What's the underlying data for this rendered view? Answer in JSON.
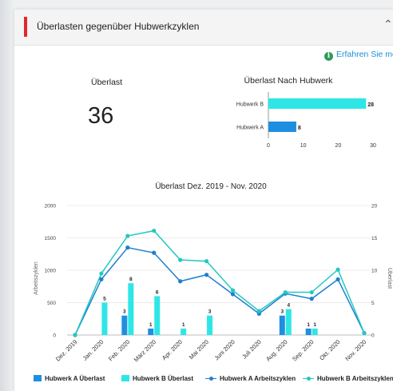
{
  "widget": {
    "title": "Überlasten gegenüber Hubwerkzyklen",
    "learn_more": "Erfahren Sie mehr",
    "collapse_icon": "chevron-up-icon",
    "info_icon": "info-icon"
  },
  "kpi": {
    "label": "Überlast",
    "value": "36"
  },
  "colors": {
    "accent": "#e3262d",
    "hubwerk_a": "#1e8fe0",
    "hubwerk_b": "#2ee6e6",
    "line_a": "#1f7fcf",
    "line_b": "#22c8c2"
  },
  "chart_data": [
    {
      "type": "bar",
      "orientation": "horizontal",
      "title": "Überlast Nach Hubwerk",
      "categories": [
        "Hubwerk B",
        "Hubwerk A"
      ],
      "values": [
        28,
        8
      ],
      "data_labels": [
        "28",
        "8"
      ],
      "xlim": [
        0,
        30
      ],
      "xticks": [
        "0",
        "10",
        "20",
        "30"
      ]
    },
    {
      "type": "bar",
      "title": "Überlast Dez. 2019 - Nov. 2020",
      "categories": [
        "Dez. 2019",
        "Jan. 2020",
        "Feb. 2020",
        "März 2020",
        "Apr. 2020",
        "Mai 2020",
        "Juni 2020",
        "Juli 2020",
        "Aug. 2020",
        "Sep. 2020",
        "Okt. 2020",
        "Nov. 2020"
      ],
      "ylabel_left": "Arbeitszyklen",
      "ylabel_right": "Überlast",
      "ylim_left": [
        0,
        2000
      ],
      "ylim_right": [
        0,
        20
      ],
      "yticks_left": [
        "0",
        "500",
        "1000",
        "1500",
        "2000"
      ],
      "yticks_right": [
        "0",
        "5",
        "10",
        "15",
        "20"
      ],
      "series": [
        {
          "name": "Hubwerk A Überlast",
          "kind": "bar",
          "axis": "right",
          "values": [
            0,
            0,
            3,
            1,
            0,
            0,
            0,
            0,
            3,
            1,
            0,
            0
          ],
          "data_labels": [
            "",
            "",
            "3",
            "1",
            "",
            "",
            "",
            "",
            "3",
            "1",
            "",
            ""
          ]
        },
        {
          "name": "Hubwerk B Überlast",
          "kind": "bar",
          "axis": "right",
          "values": [
            0,
            5,
            8,
            6,
            1,
            3,
            0,
            0,
            4,
            1,
            0,
            0
          ],
          "data_labels": [
            "",
            "5",
            "8",
            "6",
            "1",
            "3",
            "",
            "",
            "4",
            "1",
            "",
            ""
          ]
        },
        {
          "name": "Hubwerk A Arbeitszyklen",
          "kind": "line",
          "axis": "left",
          "values": [
            0,
            860,
            1350,
            1270,
            830,
            930,
            630,
            330,
            640,
            560,
            860,
            30
          ]
        },
        {
          "name": "Hubwerk B Arbeitszyklen",
          "kind": "line",
          "axis": "left",
          "values": [
            0,
            950,
            1530,
            1610,
            1160,
            1140,
            690,
            370,
            660,
            660,
            1010,
            30
          ]
        }
      ],
      "legend": "bottom"
    }
  ]
}
